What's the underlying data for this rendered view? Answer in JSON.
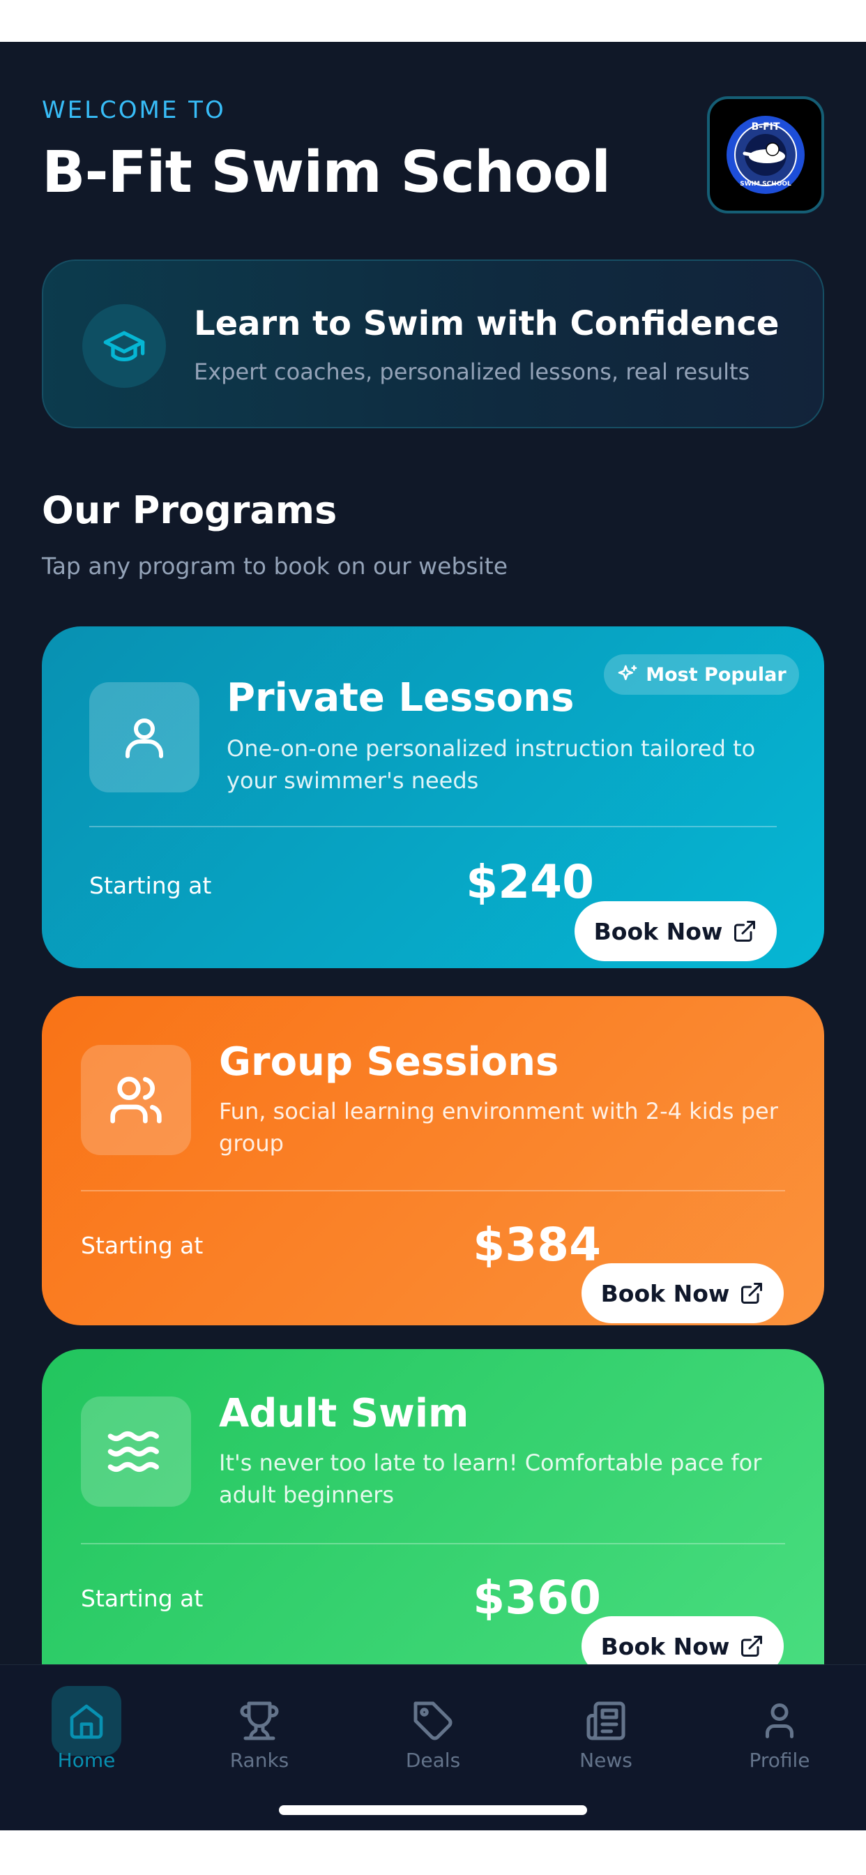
{
  "header": {
    "welcome": "WELCOME TO",
    "title": "B-Fit Swim School",
    "logo": {
      "top_text": "B-FIT",
      "bottom_text": "SWIM SCHOOL",
      "icon": "swimmer-logo"
    }
  },
  "banner": {
    "icon": "graduation-cap-icon",
    "title": "Learn to Swim with Confidence",
    "subtitle": "Expert coaches, personalized lessons, real results"
  },
  "programs": {
    "title": "Our Programs",
    "subtitle": "Tap any program to book on our website",
    "items": [
      {
        "icon": "user-icon",
        "title": "Private Lessons",
        "desc_line1": "One-on-one personalized instruction tailored to",
        "desc_line2": "your swimmer's needs",
        "badge": "Most Popular",
        "starting_label": "Starting at",
        "price": "$240",
        "button": "Book Now",
        "color": "#06b6d4"
      },
      {
        "icon": "users-icon",
        "title": "Group Sessions",
        "desc_line1": "Fun, social learning environment with 2-4 kids per",
        "desc_line2": "group",
        "starting_label": "Starting at",
        "price": "$384",
        "button": "Book Now",
        "color": "#f97316"
      },
      {
        "icon": "waves-icon",
        "title": "Adult Swim",
        "desc_line1": "It's never too late to learn! Comfortable pace for",
        "desc_line2": "adult beginners",
        "starting_label": "Starting at",
        "price": "$360",
        "button": "Book Now",
        "color": "#22c55e"
      }
    ]
  },
  "nav": {
    "items": [
      {
        "label": "Home",
        "icon": "home-icon",
        "active": true
      },
      {
        "label": "Ranks",
        "icon": "trophy-icon"
      },
      {
        "label": "Deals",
        "icon": "tag-icon"
      },
      {
        "label": "News",
        "icon": "newspaper-icon"
      },
      {
        "label": "Profile",
        "icon": "profile-icon"
      }
    ],
    "active_color": "#0891b2"
  }
}
